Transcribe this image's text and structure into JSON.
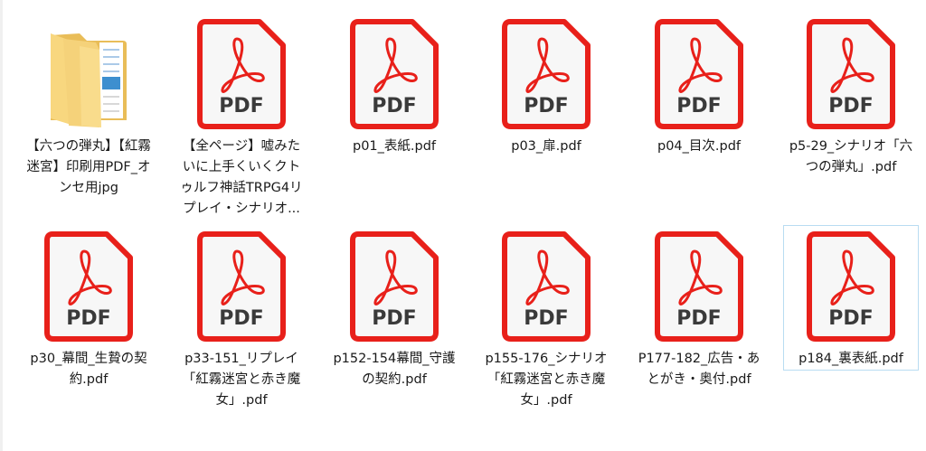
{
  "items": [
    {
      "label": "【六つの弾丸】【紅霧迷宮】印刷用PDF_オンセ用jpg",
      "type": "folder"
    },
    {
      "label": "【全ページ】嘘みたいに上手くいくクトゥルフ神話TRPG4リプレイ・シナリオ...",
      "type": "pdf"
    },
    {
      "label": "p01_表紙.pdf",
      "type": "pdf"
    },
    {
      "label": "p03_扉.pdf",
      "type": "pdf"
    },
    {
      "label": "p04_目次.pdf",
      "type": "pdf"
    },
    {
      "label": "p5-29_シナリオ「六つの弾丸」.pdf",
      "type": "pdf"
    },
    {
      "label": "p30_幕間_生贄の契約.pdf",
      "type": "pdf"
    },
    {
      "label": "p33-151_リプレイ「紅霧迷宮と赤き魔女」.pdf",
      "type": "pdf"
    },
    {
      "label": "p152-154幕間_守護の契約.pdf",
      "type": "pdf"
    },
    {
      "label": "p155-176_シナリオ「紅霧迷宮と赤き魔女」.pdf",
      "type": "pdf"
    },
    {
      "label": "P177-182_広告・あとがき・奥付.pdf",
      "type": "pdf"
    },
    {
      "label": "p184_裏表紙.pdf",
      "type": "pdf",
      "selected": true
    }
  ],
  "pdf_icon_text": "PDF",
  "colors": {
    "pdf_red": "#e8201a",
    "folder": "#f5d27a",
    "selection_border": "#b9dcf2"
  }
}
